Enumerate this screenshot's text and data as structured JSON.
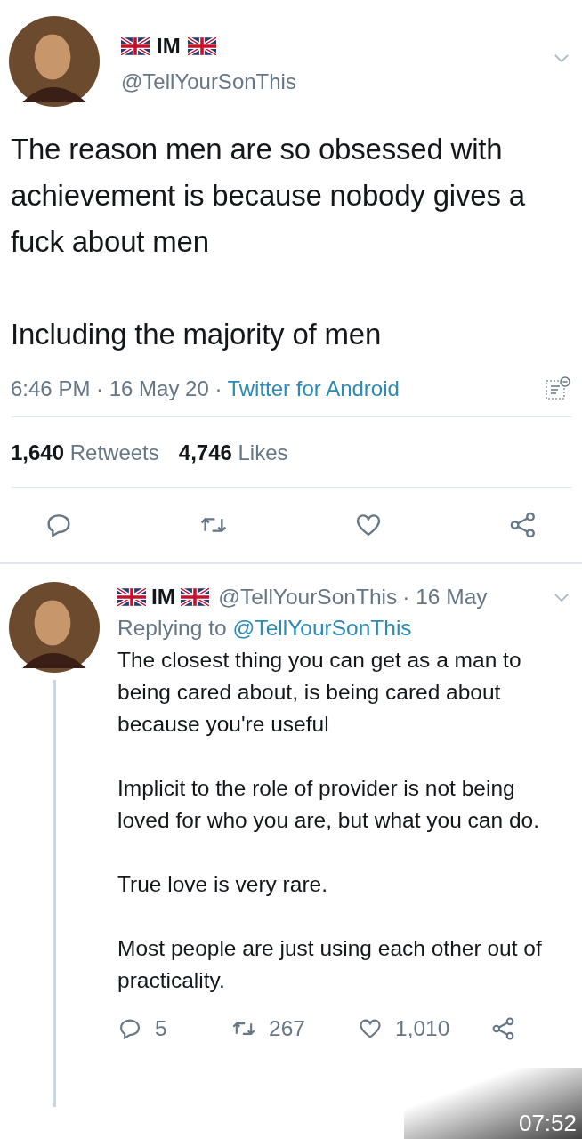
{
  "tweet": {
    "name": "IM",
    "handle": "@TellYourSonThis",
    "paragraphs": [
      "The reason men are so obsessed with achievement is because nobody gives a fuck about men",
      "Including the majority of men"
    ],
    "timestamp": "6:46 PM · 16 May 20 ·",
    "source": "Twitter for Android",
    "stats": [
      {
        "count": "1,640",
        "label": "Retweets"
      },
      {
        "count": "4,746",
        "label": "Likes"
      }
    ]
  },
  "reply": {
    "name": "IM",
    "handle": "@TellYourSonThis",
    "date": "· 16 May",
    "replying_label": "Replying to",
    "replying_handle": "@TellYourSonThis",
    "paragraphs": [
      "The closest thing you can get as a man to being cared about, is being cared about because you're useful",
      "Implicit to the role of provider is not being loved for who you are, but what you can do.",
      "True love is very rare.",
      "Most people are just using each other out of practicality."
    ],
    "actions": [
      {
        "kind": "reply",
        "count": "5"
      },
      {
        "kind": "retweet",
        "count": "267"
      },
      {
        "kind": "like",
        "count": "1,010"
      },
      {
        "kind": "share"
      }
    ]
  },
  "video_time": "07:52"
}
